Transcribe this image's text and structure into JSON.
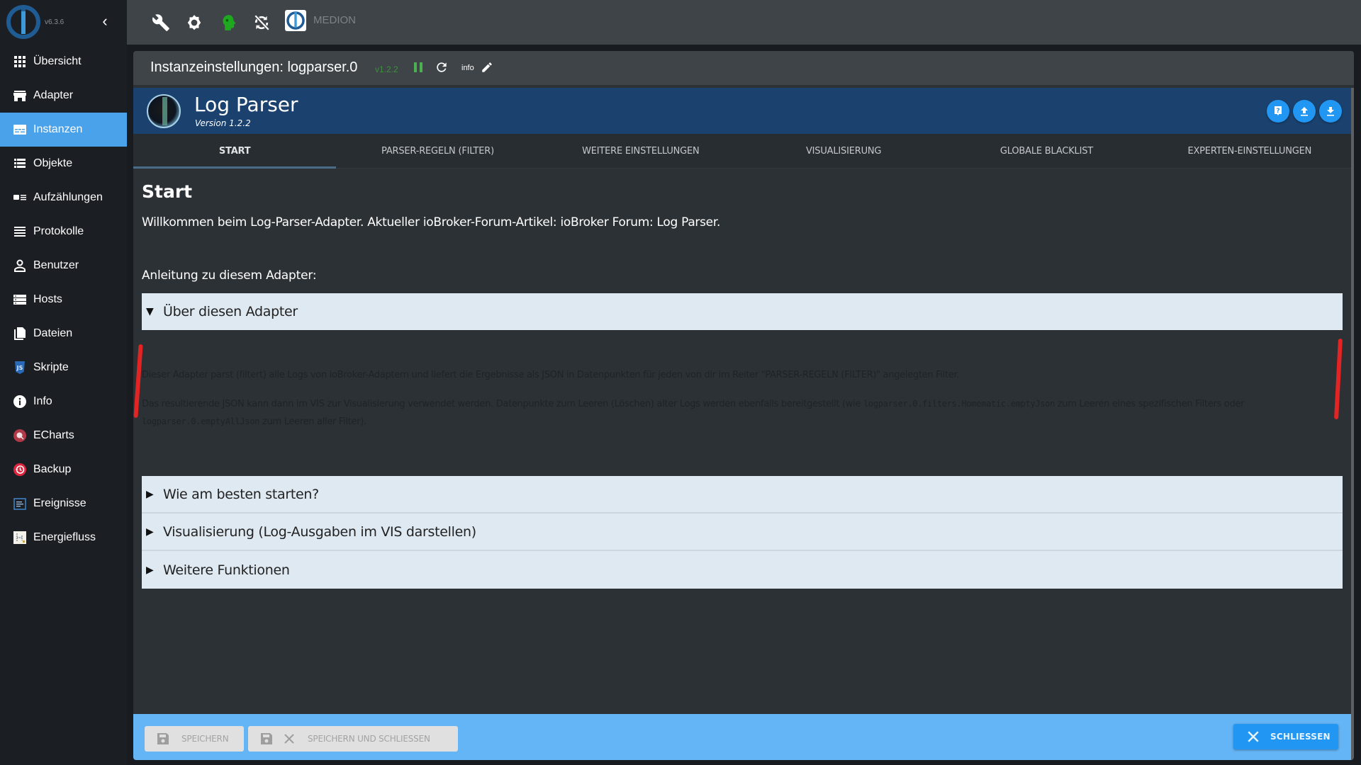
{
  "sidebar": {
    "version": "v6.3.6",
    "collapse_icon": "chevron-left-icon",
    "items": [
      {
        "label": "Übersicht",
        "icon": "grid-icon",
        "active": false
      },
      {
        "label": "Adapter",
        "icon": "store-icon",
        "active": false
      },
      {
        "label": "Instanzen",
        "icon": "instances-icon",
        "active": true
      },
      {
        "label": "Objekte",
        "icon": "list-icon",
        "active": false
      },
      {
        "label": "Aufzählungen",
        "icon": "enum-icon",
        "active": false
      },
      {
        "label": "Protokolle",
        "icon": "log-lines-icon",
        "active": false
      },
      {
        "label": "Benutzer",
        "icon": "user-icon",
        "active": false
      },
      {
        "label": "Hosts",
        "icon": "server-icon",
        "active": false
      },
      {
        "label": "Dateien",
        "icon": "files-icon",
        "active": false
      },
      {
        "label": "Skripte",
        "icon": "javascript-icon",
        "active": false
      },
      {
        "label": "Info",
        "icon": "info-icon",
        "active": false
      },
      {
        "label": "ECharts",
        "icon": "echarts-icon",
        "active": false
      },
      {
        "label": "Backup",
        "icon": "backup-icon",
        "active": false
      },
      {
        "label": "Ereignisse",
        "icon": "events-icon",
        "active": false
      },
      {
        "label": "Energiefluss",
        "icon": "energyflow-icon",
        "active": false
      }
    ]
  },
  "topbar": {
    "icons": [
      "wrench-icon",
      "settings-gear-icon",
      "expert-mode-head-icon",
      "sync-disabled-icon"
    ],
    "host_name": "MEDION"
  },
  "instance": {
    "title": "Instanzeinstellungen: logparser.0",
    "version": "v1.2.2",
    "info_label": "info",
    "status_color": "#4caf50"
  },
  "adapter": {
    "title": "Log Parser",
    "subtitle": "Version 1.2.2",
    "actions": [
      "help-icon",
      "upload-icon",
      "download-icon"
    ]
  },
  "tabs": [
    {
      "label": "START",
      "active": true
    },
    {
      "label": "PARSER-REGELN (FILTER)",
      "active": false
    },
    {
      "label": "WEITERE EINSTELLUNGEN",
      "active": false
    },
    {
      "label": "VISUALISIERUNG",
      "active": false
    },
    {
      "label": "GLOBALE BLACKLIST",
      "active": false
    },
    {
      "label": "EXPERTEN-EINSTELLUNGEN",
      "active": false
    }
  ],
  "start": {
    "heading": "Start",
    "welcome_prefix": "Willkommen beim Log-Parser-Adapter. Aktueller ioBroker-Forum-Artikel: ",
    "welcome_link": "ioBroker Forum: Log Parser",
    "welcome_suffix": ".",
    "guide_label": "Anleitung zu diesem Adapter:",
    "accordion": [
      {
        "title": "Über diesen Adapter",
        "expanded": true,
        "body_p1": "Dieser Adapter parst (filtert) alle Logs von ioBroker-Adaptern und liefert die Ergebnisse als JSON in Datenpunkten für jeden von dir im Reiter \"PARSER-REGELN (FILTER)\" angelegten Filter.",
        "body_p2_a": "Das resultierende JSON kann dann im VIS zur Visualisierung verwendet werden. Datenpunkte zum Leeren (Löschen) alter Logs werden ebenfalls bereitgestellt (wie ",
        "body_p2_code1": "logparser.0.filters.Homematic.emptyJson",
        "body_p2_b": " zum Leeren eines spezifischen Filters oder ",
        "body_p2_code2": "logparser.0.emptyAllJson",
        "body_p2_c": " zum Leeren aller Filter)."
      },
      {
        "title": "Wie am besten starten?",
        "expanded": false
      },
      {
        "title": "Visualisierung (Log-Ausgaben im VIS darstellen)",
        "expanded": false
      },
      {
        "title": "Weitere Funktionen",
        "expanded": false
      }
    ]
  },
  "footer": {
    "save_label": "SPEICHERN",
    "save_close_label": "SPEICHERN UND SCHLIESSEN",
    "close_label": "SCHLIESSEN"
  },
  "annotation": {
    "color": "#e32424",
    "description": "red hand-drawn markers bracketing the expanded accordion body"
  }
}
